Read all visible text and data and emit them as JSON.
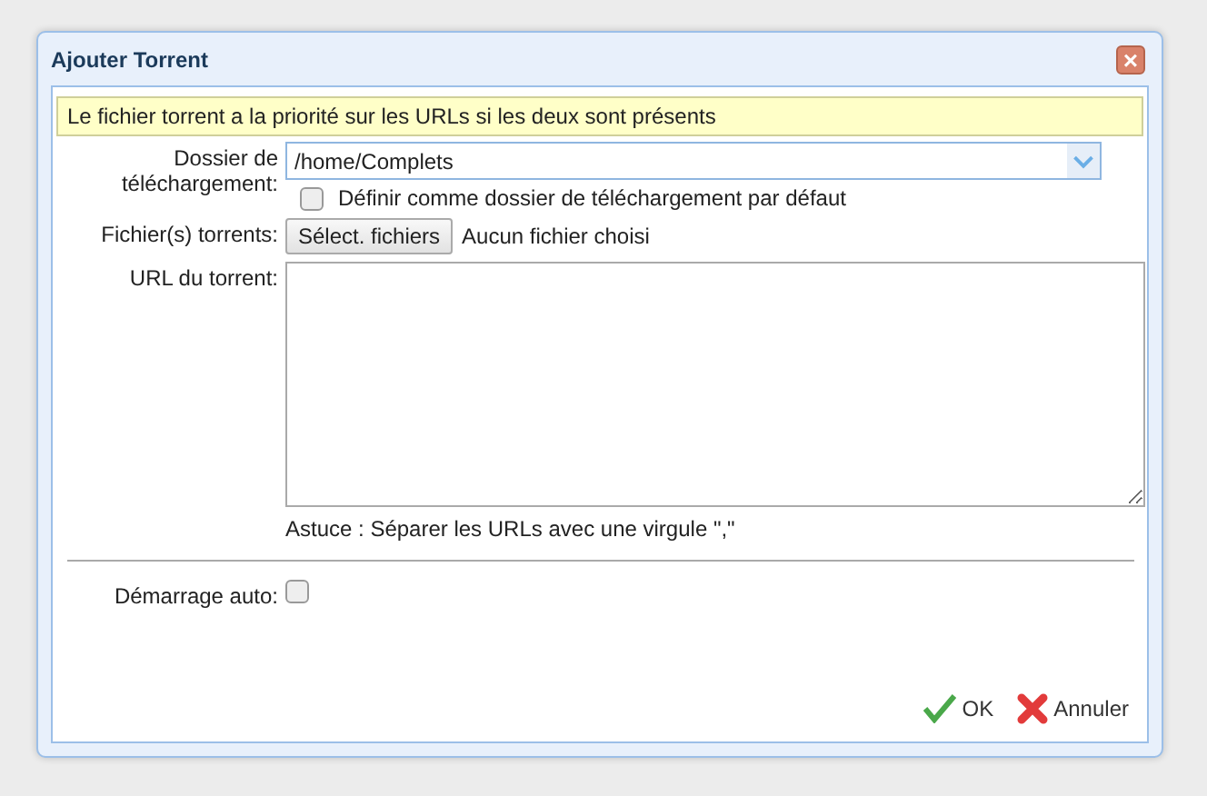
{
  "window": {
    "title": "Ajouter Torrent",
    "close": "×"
  },
  "notice": "Le fichier torrent a la priorité sur les URLs si les deux sont présents",
  "download_folder": {
    "label": "Dossier de téléchargement:",
    "value": "/home/Complets"
  },
  "default_folder": {
    "label": "Définir comme dossier de téléchargement par défaut",
    "checked": false
  },
  "torrent_files": {
    "label": "Fichier(s) torrents:",
    "button": "Sélect. fichiers",
    "status": "Aucun fichier choisi"
  },
  "torrent_url": {
    "label": "URL du torrent:",
    "hint": "Astuce : Séparer les URLs avec une virgule \",\""
  },
  "auto_start": {
    "label": "Démarrage auto:",
    "checked": false
  },
  "buttons": [
    {
      "kind": "ok",
      "label": "OK"
    },
    {
      "kind": "cancel",
      "label": "Annuler"
    }
  ]
}
